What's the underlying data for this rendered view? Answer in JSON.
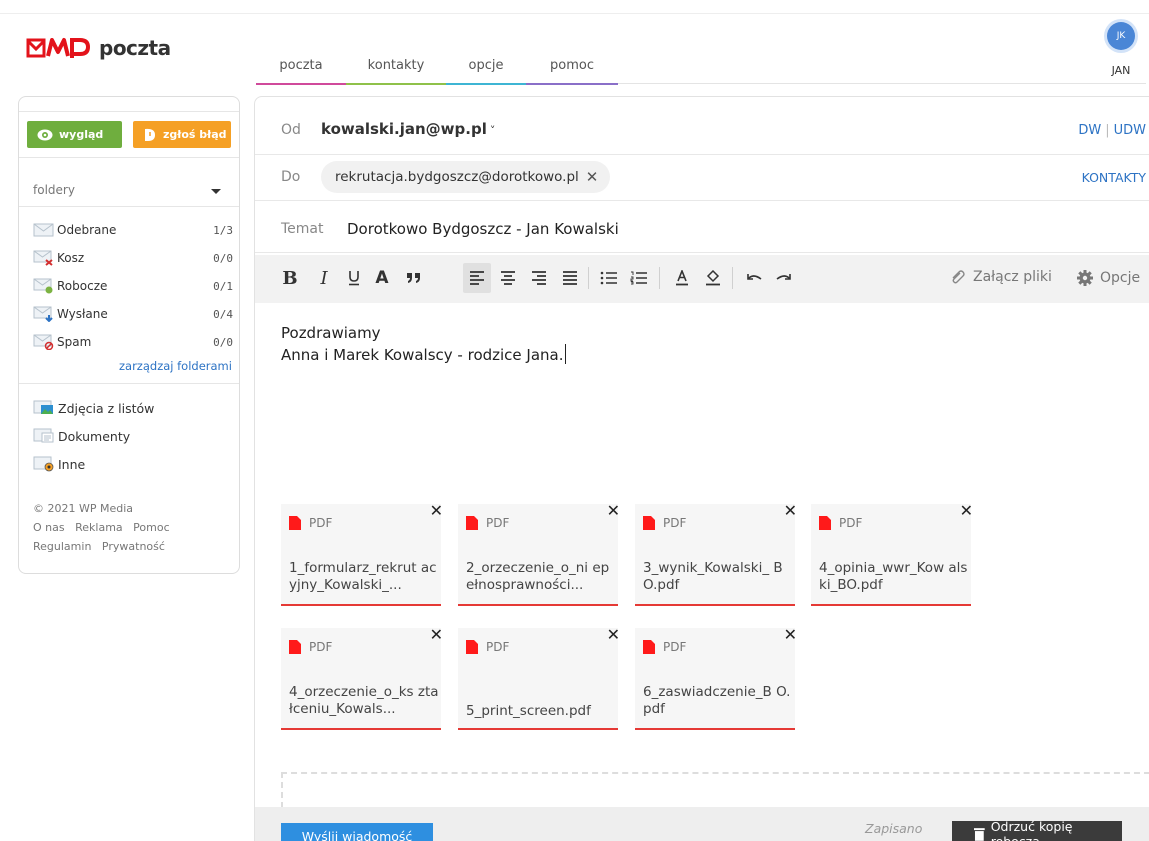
{
  "brand": {
    "name": "poczta"
  },
  "nav": {
    "tabs": [
      {
        "label": "poczta",
        "color": "#d04a9b"
      },
      {
        "label": "kontakty",
        "color": "#8fc14a"
      },
      {
        "label": "opcje",
        "color": "#3db5d4"
      },
      {
        "label": "pomoc",
        "color": "#8a6fc8"
      }
    ]
  },
  "user": {
    "initials": "JK",
    "name": "JAN"
  },
  "sidebar": {
    "buttons": {
      "wyglad": "wygląd",
      "blad": "zgłoś błąd"
    },
    "folders_label": "foldery",
    "folders": [
      {
        "name": "Odebrane",
        "count": "1/3",
        "icon": "inbox-icon"
      },
      {
        "name": "Kosz",
        "count": "0/0",
        "icon": "trash-icon"
      },
      {
        "name": "Robocze",
        "count": "0/1",
        "icon": "drafts-icon"
      },
      {
        "name": "Wysłane",
        "count": "0/4",
        "icon": "sent-icon"
      },
      {
        "name": "Spam",
        "count": "0/0",
        "icon": "spam-icon"
      }
    ],
    "manage": "zarządzaj folderami",
    "categories": [
      {
        "name": "Zdjęcia z listów",
        "icon": "photos-icon"
      },
      {
        "name": "Dokumenty",
        "icon": "documents-icon"
      },
      {
        "name": "Inne",
        "icon": "other-icon"
      }
    ],
    "footer": {
      "copyright": "© 2021 WP Media",
      "links": [
        "O nas",
        "Reklama",
        "Pomoc",
        "Regulamin",
        "Prywatność"
      ]
    }
  },
  "compose": {
    "from_label": "Od",
    "from": "kowalski.jan@wp.pl",
    "dw": "DW",
    "udw": "UDW",
    "to_label": "Do",
    "to": "rekrutacja.bydgoszcz@dorotkowo.pl",
    "contacts": "KONTAKTY",
    "subject_label": "Temat",
    "subject": "Dorotkowo Bydgoszcz - Jan Kowalski",
    "toolbar": {
      "attach": "Załącz pliki",
      "options": "Opcje"
    },
    "body_lines": [
      "Pozdrawiamy",
      "Anna i Marek Kowalscy - rodzice Jana."
    ],
    "attachments": [
      {
        "type": "PDF",
        "name": "1_formularz_rekrut acyjny_Kowalski_..."
      },
      {
        "type": "PDF",
        "name": "2_orzeczenie_o_ni epełnosprawności..."
      },
      {
        "type": "PDF",
        "name": "3_wynik_Kowalski_ BO.pdf"
      },
      {
        "type": "PDF",
        "name": "4_opinia_wwr_Kow alski_BO.pdf"
      },
      {
        "type": "PDF",
        "name": "4_orzeczenie_o_ks ztałceniu_Kowals..."
      },
      {
        "type": "PDF",
        "name": "5_print_screen.pdf"
      },
      {
        "type": "PDF",
        "name": "6_zaswiadczenie_B O.pdf"
      }
    ],
    "send": "Wyślij wiadomość",
    "saved": "Zapisano",
    "discard": "Odrzuć kopię roboczą"
  }
}
